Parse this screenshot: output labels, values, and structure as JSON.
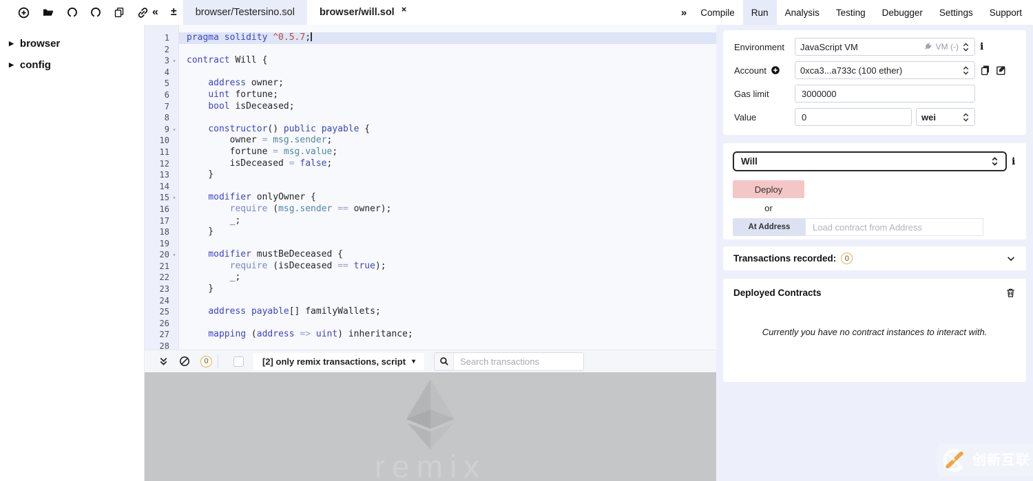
{
  "glyphs": {
    "collapse_left": "«",
    "font_size": "±",
    "expand_menu": "»",
    "tab_close": "×",
    "caret_down": "▾",
    "caret_right": "▶",
    "fold": "▾"
  },
  "topbar": {
    "left_icons": [
      "plus-circle-icon",
      "folder-open-icon",
      "gist-import-icon",
      "gist-publish-icon",
      "copy-files-icon",
      "link-icon"
    ],
    "tabs": [
      {
        "label": "browser/Testersino.sol",
        "active": false
      },
      {
        "label": "browser/will.sol",
        "active": true
      }
    ],
    "menu": [
      {
        "label": "Compile",
        "active": false
      },
      {
        "label": "Run",
        "active": true
      },
      {
        "label": "Analysis",
        "active": false
      },
      {
        "label": "Testing",
        "active": false
      },
      {
        "label": "Debugger",
        "active": false
      },
      {
        "label": "Settings",
        "active": false
      },
      {
        "label": "Support",
        "active": false
      }
    ]
  },
  "sidebar": {
    "items": [
      "browser",
      "config"
    ]
  },
  "editor": {
    "current_line": 1,
    "fold_lines": [
      3,
      9,
      15,
      20
    ],
    "lines": [
      {
        "n": 1,
        "tokens": [
          [
            "kw",
            "pragma solidity "
          ],
          [
            "ver",
            "^0.5.7"
          ],
          [
            "pl",
            ";"
          ]
        ]
      },
      {
        "n": 2,
        "tokens": []
      },
      {
        "n": 3,
        "tokens": [
          [
            "kw",
            "contract"
          ],
          [
            "pl",
            " Will {"
          ]
        ]
      },
      {
        "n": 4,
        "tokens": []
      },
      {
        "n": 5,
        "tokens": [
          [
            "pl",
            "    "
          ],
          [
            "kw",
            "address"
          ],
          [
            "pl",
            " owner;"
          ]
        ]
      },
      {
        "n": 6,
        "tokens": [
          [
            "pl",
            "    "
          ],
          [
            "kw",
            "uint"
          ],
          [
            "pl",
            " fortune;"
          ]
        ]
      },
      {
        "n": 7,
        "tokens": [
          [
            "pl",
            "    "
          ],
          [
            "kw",
            "bool"
          ],
          [
            "pl",
            " isDeceased;"
          ]
        ]
      },
      {
        "n": 8,
        "tokens": []
      },
      {
        "n": 9,
        "tokens": [
          [
            "pl",
            "    "
          ],
          [
            "kw",
            "constructor"
          ],
          [
            "pl",
            "() "
          ],
          [
            "kw",
            "public"
          ],
          [
            "pl",
            " "
          ],
          [
            "kw",
            "payable"
          ],
          [
            "pl",
            " {"
          ]
        ]
      },
      {
        "n": 10,
        "tokens": [
          [
            "pl",
            "        owner "
          ],
          [
            "op",
            "="
          ],
          [
            "pl",
            " "
          ],
          [
            "mem",
            "msg.sender"
          ],
          [
            "pl",
            ";"
          ]
        ]
      },
      {
        "n": 11,
        "tokens": [
          [
            "pl",
            "        fortune "
          ],
          [
            "op",
            "="
          ],
          [
            "pl",
            " "
          ],
          [
            "mem",
            "msg.value"
          ],
          [
            "pl",
            ";"
          ]
        ]
      },
      {
        "n": 12,
        "tokens": [
          [
            "pl",
            "        isDeceased "
          ],
          [
            "op",
            "="
          ],
          [
            "pl",
            " "
          ],
          [
            "kw",
            "false"
          ],
          [
            "pl",
            ";"
          ]
        ]
      },
      {
        "n": 13,
        "tokens": [
          [
            "pl",
            "    }"
          ]
        ]
      },
      {
        "n": 14,
        "tokens": []
      },
      {
        "n": 15,
        "tokens": [
          [
            "pl",
            "    "
          ],
          [
            "kw",
            "modifier"
          ],
          [
            "pl",
            " onlyOwner {"
          ]
        ]
      },
      {
        "n": 16,
        "tokens": [
          [
            "pl",
            "        "
          ],
          [
            "fn",
            "require"
          ],
          [
            "pl",
            " ("
          ],
          [
            "mem",
            "msg.sender"
          ],
          [
            "pl",
            " "
          ],
          [
            "op",
            "=="
          ],
          [
            "pl",
            " owner);"
          ]
        ]
      },
      {
        "n": 17,
        "tokens": [
          [
            "pl",
            "        _;"
          ]
        ]
      },
      {
        "n": 18,
        "tokens": [
          [
            "pl",
            "    }"
          ]
        ]
      },
      {
        "n": 19,
        "tokens": []
      },
      {
        "n": 20,
        "tokens": [
          [
            "pl",
            "    "
          ],
          [
            "kw",
            "modifier"
          ],
          [
            "pl",
            " mustBeDeceased {"
          ]
        ]
      },
      {
        "n": 21,
        "tokens": [
          [
            "pl",
            "        "
          ],
          [
            "fn",
            "require"
          ],
          [
            "pl",
            " (isDeceased "
          ],
          [
            "op",
            "=="
          ],
          [
            "pl",
            " "
          ],
          [
            "kw",
            "true"
          ],
          [
            "pl",
            ");"
          ]
        ]
      },
      {
        "n": 22,
        "tokens": [
          [
            "pl",
            "        _;"
          ]
        ]
      },
      {
        "n": 23,
        "tokens": [
          [
            "pl",
            "    }"
          ]
        ]
      },
      {
        "n": 24,
        "tokens": []
      },
      {
        "n": 25,
        "tokens": [
          [
            "pl",
            "    "
          ],
          [
            "kw",
            "address"
          ],
          [
            "pl",
            " "
          ],
          [
            "kw",
            "payable"
          ],
          [
            "pl",
            "[] familyWallets;"
          ]
        ]
      },
      {
        "n": 26,
        "tokens": []
      },
      {
        "n": 27,
        "tokens": [
          [
            "pl",
            "    "
          ],
          [
            "kw",
            "mapping"
          ],
          [
            "pl",
            " ("
          ],
          [
            "kw",
            "address"
          ],
          [
            "pl",
            " "
          ],
          [
            "op",
            "=>"
          ],
          [
            "pl",
            " "
          ],
          [
            "kw",
            "uint"
          ],
          [
            "pl",
            ") inheritance;"
          ]
        ]
      },
      {
        "n": 28,
        "tokens": []
      }
    ]
  },
  "run_panel": {
    "environment": {
      "label": "Environment",
      "value": "JavaScript VM",
      "vm_label": "VM (-)"
    },
    "account": {
      "label": "Account",
      "value": "0xca3...a733c (100 ether)"
    },
    "gas_limit": {
      "label": "Gas limit",
      "value": "3000000"
    },
    "value": {
      "label": "Value",
      "value": "0",
      "unit": "wei"
    },
    "contract": {
      "value": "Will"
    },
    "deploy_label": "Deploy",
    "or_label": "or",
    "at_address_label": "At Address",
    "at_address_placeholder": "Load contract from Address",
    "info_icon": "i",
    "transactions": {
      "label": "Transactions recorded:",
      "count": "0"
    },
    "deployed": {
      "title": "Deployed Contracts",
      "empty_message": "Currently you have no contract instances to interact with."
    }
  },
  "terminal": {
    "badge_count": "0",
    "filter_label": "[2] only remix transactions, script",
    "search_placeholder": "Search transactions",
    "watermark": "remix"
  },
  "overlay": {
    "brand_text": "创新互联"
  },
  "colors": {
    "accent_panel": "#edf0fa",
    "tab_inactive": "#e9ecf9",
    "menu_active": "#e7eaf8",
    "deploy_button": "#f5c6c6",
    "at_address_button": "#dde2f3",
    "badge_ring": "#dcb64f",
    "terminal_gray": "#c5c6c7",
    "keyword_blue": "#3d43c8",
    "version_red": "#c0453e",
    "member_teal": "#4e86a0",
    "brand_orange": "#f2a53c"
  }
}
